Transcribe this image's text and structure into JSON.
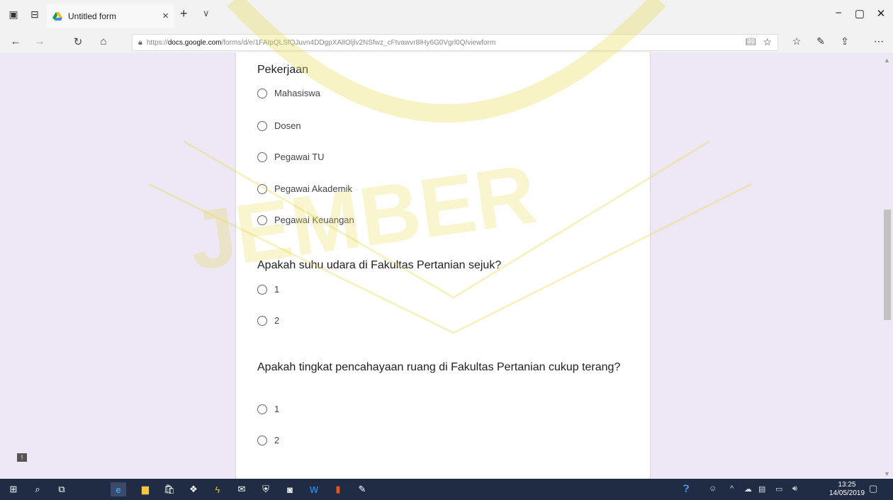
{
  "browser": {
    "tab_title": "Untitled form",
    "tab_close": "×",
    "new_tab": "+",
    "tab_menu": "∨",
    "url_prefix": "https://",
    "url_host": "docs.google.com",
    "url_path": "/forms/d/e/1FAIpQLSfQJuvn4DDgpXAlIOljlv2NSfwz_cFtvawvr8lHy6G0Vgrl0Q/viewform",
    "window": {
      "minimize": "−",
      "restore": "▢",
      "close": "✕"
    }
  },
  "form": {
    "questions": [
      {
        "title": "Pekerjaan",
        "options": [
          "Mahasiswa",
          "Dosen",
          "Pegawai TU",
          "Pegawai Akademik",
          "Pegawai Keuangan"
        ]
      },
      {
        "title": "Apakah suhu udara di Fakultas Pertanian sejuk?",
        "options": [
          "1",
          "2"
        ]
      },
      {
        "title": "Apakah tingkat pencahayaan ruang di Fakultas Pertanian cukup terang?",
        "options": [
          "1",
          "2"
        ]
      }
    ]
  },
  "watermark": "JEMBER",
  "taskbar": {
    "time": "13:25",
    "date": "14/05/2019",
    "icons": [
      "windows-start-icon",
      "search-icon",
      "task-view-icon",
      "edge-icon",
      "file-explorer-icon",
      "store-icon",
      "dropbox-icon",
      "winamp-icon",
      "mail-icon",
      "shield-icon",
      "camera-icon",
      "word-icon",
      "office-icon",
      "paint-icon"
    ]
  },
  "colors": {
    "page_bg": "#ede7f6",
    "taskbar": "#202b44",
    "watermark": "#e8dc55"
  }
}
